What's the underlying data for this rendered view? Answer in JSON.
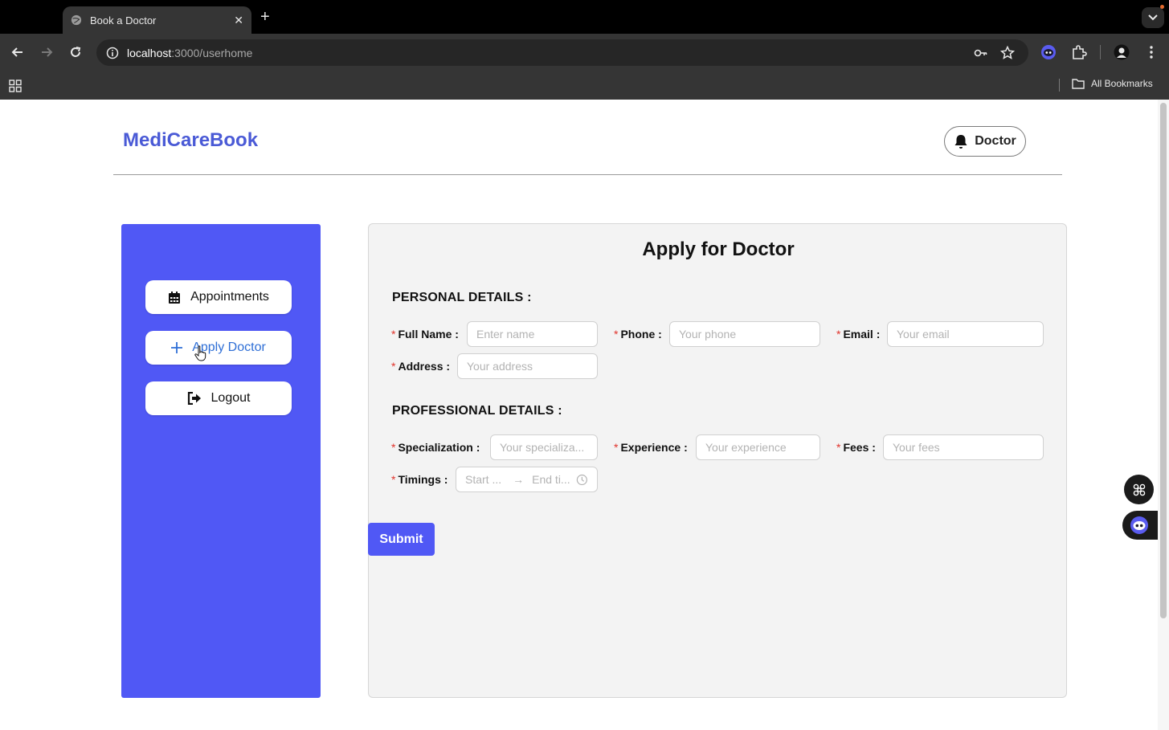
{
  "browser": {
    "tab_title": "Book a Doctor",
    "url_host": "localhost",
    "url_path": ":3000/userhome",
    "bookmarks_label": "All Bookmarks"
  },
  "header": {
    "logo": "MediCareBook",
    "user_button_label": "Doctor"
  },
  "sidebar": {
    "items": [
      {
        "label": "Appointments",
        "icon": "calendar-icon"
      },
      {
        "label": "Apply Doctor",
        "icon": "plus-icon",
        "active": true
      },
      {
        "label": "Logout",
        "icon": "logout-icon"
      }
    ]
  },
  "form": {
    "title": "Apply for Doctor",
    "personal_title": "PERSONAL DETAILS :",
    "professional_title": "PROFESSIONAL DETAILS :",
    "fields": {
      "full_name": {
        "label": "Full Name",
        "placeholder": "Enter name"
      },
      "phone": {
        "label": "Phone",
        "placeholder": "Your phone"
      },
      "email": {
        "label": "Email",
        "placeholder": "Your email"
      },
      "address": {
        "label": "Address",
        "placeholder": "Your address"
      },
      "specialization": {
        "label": "Specialization",
        "placeholder": "Your specializa..."
      },
      "experience": {
        "label": "Experience",
        "placeholder": "Your experience"
      },
      "fees": {
        "label": "Fees",
        "placeholder": "Your fees"
      },
      "timings": {
        "label": "Timings",
        "start_placeholder": "Start ...",
        "end_placeholder": "End ti..."
      }
    },
    "required_mark": "*",
    "colon": ":",
    "submit_label": "Submit"
  },
  "colors": {
    "brand": "#4a5ad6",
    "sidebar": "#5058f5",
    "required": "#e0342c"
  }
}
